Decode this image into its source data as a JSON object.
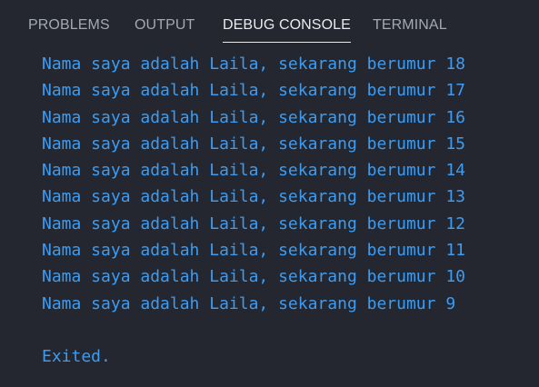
{
  "tabs": [
    {
      "label": "PROBLEMS"
    },
    {
      "label": "OUTPUT"
    },
    {
      "label": "DEBUG CONSOLE",
      "active": true
    },
    {
      "label": "TERMINAL"
    }
  ],
  "console": {
    "lines": [
      "Nama saya adalah Laila, sekarang berumur 18",
      "Nama saya adalah Laila, sekarang berumur 17",
      "Nama saya adalah Laila, sekarang berumur 16",
      "Nama saya adalah Laila, sekarang berumur 15",
      "Nama saya adalah Laila, sekarang berumur 14",
      "Nama saya adalah Laila, sekarang berumur 13",
      "Nama saya adalah Laila, sekarang berumur 12",
      "Nama saya adalah Laila, sekarang berumur 11",
      "Nama saya adalah Laila, sekarang berumur 10",
      "Nama saya adalah Laila, sekarang berumur 9"
    ],
    "exit_message": "Exited."
  },
  "colors": {
    "background": "#24272f",
    "tab_inactive": "#a4a8b2",
    "tab_active": "#e9ebef",
    "console_text": "#3d9cf2"
  }
}
